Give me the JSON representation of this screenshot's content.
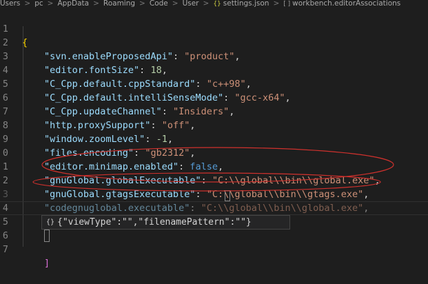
{
  "breadcrumb": {
    "segments": [
      "Users",
      "pc",
      "AppData",
      "Roaming",
      "Code",
      "User"
    ],
    "file_icon": "{}",
    "file": "settings.json",
    "symbol_icon": "[ ]",
    "symbol": "workbench.editorAssociations"
  },
  "lines": [
    {
      "num": "1",
      "open_brace": "{"
    },
    {
      "num": "2",
      "key": "\"svn.enableProposedApi\"",
      "colon": ": ",
      "value": "\"product\"",
      "value_type": "str",
      "end": ","
    },
    {
      "num": "3",
      "key": "\"editor.fontSize\"",
      "colon": ": ",
      "value": "18",
      "value_type": "num",
      "end": ","
    },
    {
      "num": "4",
      "key": "\"C_Cpp.default.cppStandard\"",
      "colon": ": ",
      "value": "\"c++98\"",
      "value_type": "str",
      "end": ","
    },
    {
      "num": "5",
      "key": "\"C_Cpp.default.intelliSenseMode\"",
      "colon": ": ",
      "value": "\"gcc-x64\"",
      "value_type": "str",
      "end": ","
    },
    {
      "num": "6",
      "key": "\"C_Cpp.updateChannel\"",
      "colon": ": ",
      "value": "\"Insiders\"",
      "value_type": "str",
      "end": ","
    },
    {
      "num": "7",
      "key": "\"http.proxySupport\"",
      "colon": ": ",
      "value": "\"off\"",
      "value_type": "str",
      "end": ","
    },
    {
      "num": "8",
      "key": "\"window.zoomLevel\"",
      "colon": ": ",
      "value": "-1",
      "value_type": "num",
      "end": ","
    },
    {
      "num": "9",
      "key": "\"files.encoding\"",
      "colon": ": ",
      "value": "\"gb2312\"",
      "value_type": "str",
      "end": ","
    },
    {
      "num": "0",
      "key": "\"editor.minimap.enabled\"",
      "colon": ": ",
      "value": "false",
      "value_type": "kw",
      "end": ","
    },
    {
      "num": "1",
      "key": "\"gnuGlobal.globalExecutable\"",
      "colon": ": ",
      "value": "\"C:\\\\global\\\\bin\\\\global.exe\"",
      "value_type": "str",
      "end": ","
    },
    {
      "num": "2",
      "key": "\"gnuGlobal.gtagsExecutable\"",
      "colon": ": ",
      "value": "\"C:\\\\global\\\\bin\\\\gtags.exe\"",
      "value_type": "str",
      "end": ","
    },
    {
      "num": "3",
      "key": "\"codegnuglobal.executable\"",
      "colon": ": ",
      "value": "\"C:\\\\global\\\\bin\\\\global.exe\"",
      "value_type": "str",
      "end": ","
    },
    {
      "num": "4",
      "key": "\"workbench.editorAssociations\"",
      "colon": ": ",
      "open_bracket": "["
    },
    {
      "num": "5"
    },
    {
      "num": "6"
    },
    {
      "num": "7",
      "close_bracket": "]"
    }
  ],
  "suggestion": {
    "icon": "{}",
    "text": "{\"viewType\":\"\",\"filenamePattern\":\"\"}"
  },
  "colors": {
    "background": "#1e1e1e",
    "key": "#9cdcfe",
    "string": "#ce9178",
    "number": "#b5cea8",
    "keyword": "#569cd6",
    "brace": "#ffd700",
    "bracket": "#da70d6",
    "line_number": "#858585",
    "annotation": "#d0312d"
  }
}
